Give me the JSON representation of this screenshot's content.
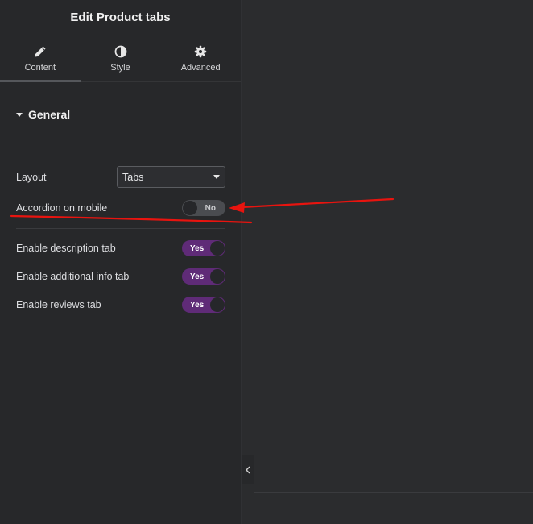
{
  "header": {
    "title": "Edit Product tabs"
  },
  "tabs": [
    {
      "label": "Content",
      "icon": "pencil-icon",
      "active": true
    },
    {
      "label": "Style",
      "icon": "contrast-icon",
      "active": false
    },
    {
      "label": "Advanced",
      "icon": "gear-icon",
      "active": false
    }
  ],
  "section": {
    "title": "General",
    "expanded": true
  },
  "fields": {
    "layout": {
      "label": "Layout",
      "value": "Tabs"
    },
    "accordion": {
      "label": "Accordion on mobile",
      "state": "No"
    },
    "description_tab": {
      "label": "Enable description tab",
      "state": "Yes"
    },
    "additional_info_tab": {
      "label": "Enable additional info tab",
      "state": "Yes"
    },
    "reviews_tab": {
      "label": "Enable reviews tab",
      "state": "Yes"
    }
  },
  "colors": {
    "toggle_on": "#5f2b77",
    "annotation": "#e8140f",
    "panel_bg": "#27282a"
  }
}
